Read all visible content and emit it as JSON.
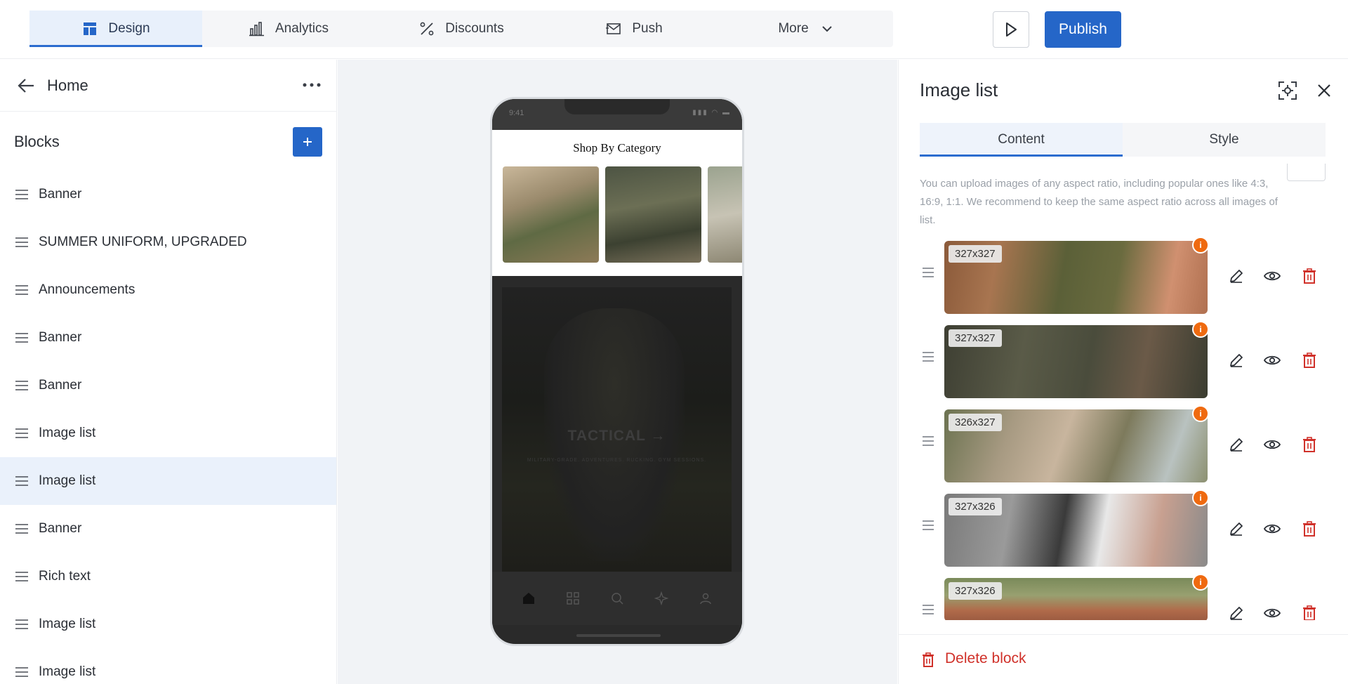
{
  "topbar": {
    "tabs": [
      {
        "label": "Design",
        "icon": "layout-icon"
      },
      {
        "label": "Analytics",
        "icon": "bar-chart-icon"
      },
      {
        "label": "Discounts",
        "icon": "percent-icon"
      },
      {
        "label": "Push",
        "icon": "mail-icon"
      },
      {
        "label": "More",
        "icon": "chevron-down-icon"
      }
    ],
    "active_tab": "Design",
    "publish_label": "Publish"
  },
  "sidebar": {
    "page_title": "Home",
    "blocks_title": "Blocks",
    "blocks": [
      "Banner",
      "SUMMER UNIFORM, UPGRADED",
      "Announcements",
      "Banner",
      "Banner",
      "Image list",
      "Image list",
      "Banner",
      "Rich text",
      "Image list",
      "Image list"
    ],
    "selected_index": 6
  },
  "preview": {
    "status_time": "9:41",
    "shop_title": "Shop By Category",
    "hero_title": "TACTICAL →",
    "hero_subtitle": "MILITARY-GRADE. ADVENTURES. RUCKING. GYM SESSIONS."
  },
  "panel": {
    "title": "Image list",
    "tabs": [
      "Content",
      "Style"
    ],
    "active_tab": "Content",
    "help_text": "You can upload images of any aspect ratio, including popular ones like 4:3, 16:9, 1:1. We recommend to keep the same aspect ratio across all images of list.",
    "images": [
      {
        "size": "327x327"
      },
      {
        "size": "327x327"
      },
      {
        "size": "326x327"
      },
      {
        "size": "327x326"
      },
      {
        "size": "327x326"
      }
    ],
    "delete_label": "Delete block"
  },
  "colors": {
    "accent": "#2566c8",
    "danger": "#d0312a",
    "warning": "#ef6a10",
    "selected_row": "#eaf1fb"
  }
}
